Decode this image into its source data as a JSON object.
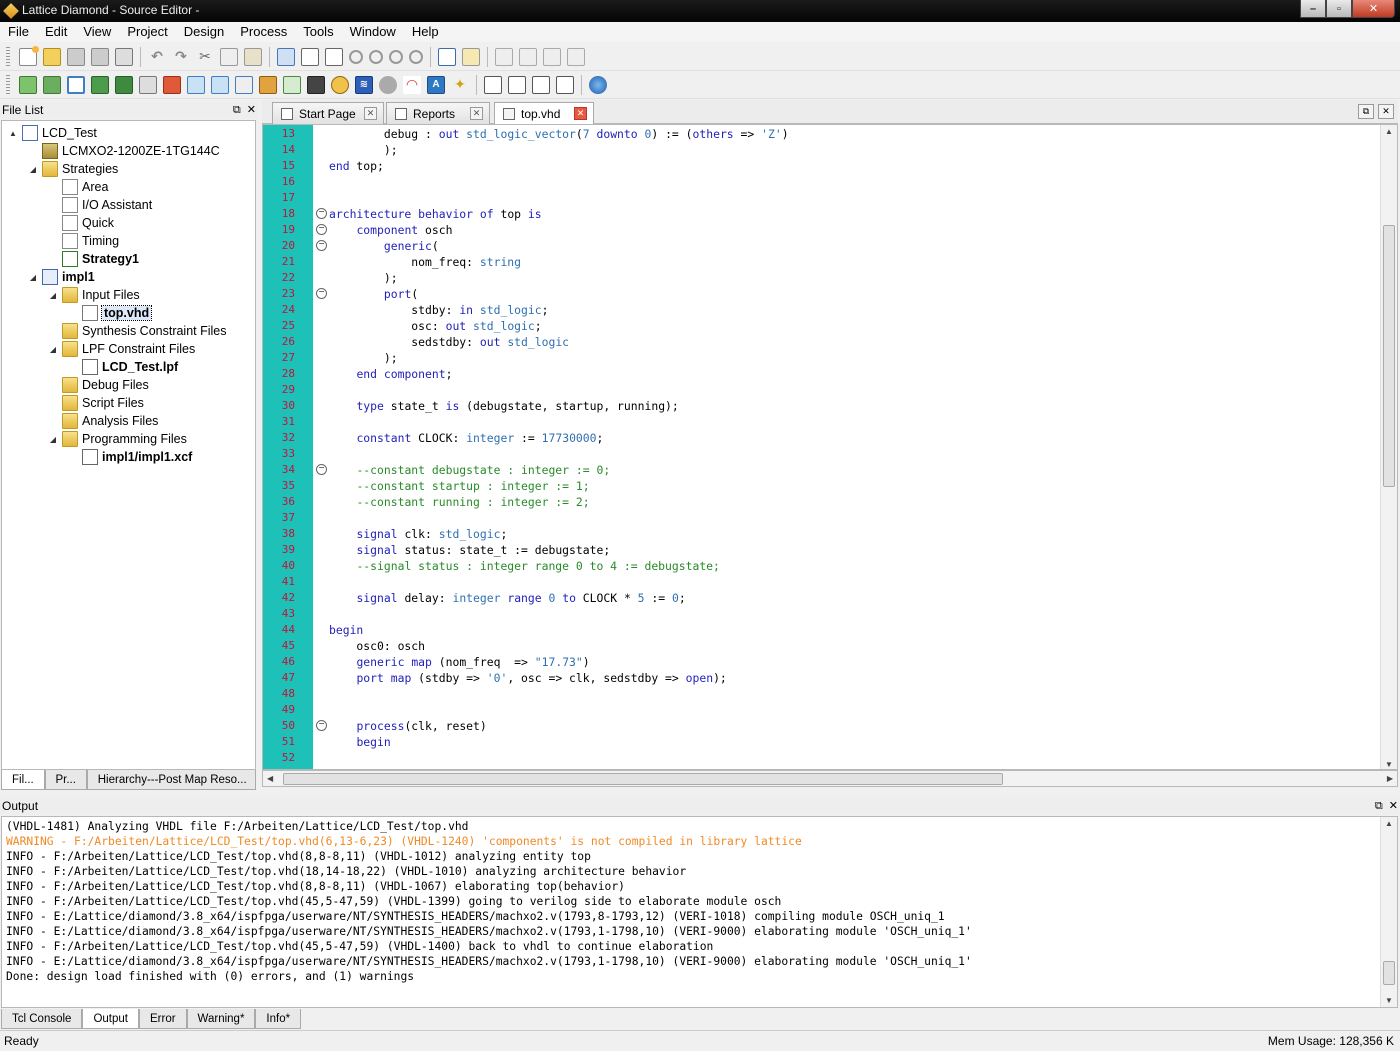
{
  "window": {
    "title": "Lattice Diamond - Source Editor -"
  },
  "menubar": [
    "File",
    "Edit",
    "View",
    "Project",
    "Design",
    "Process",
    "Tools",
    "Window",
    "Help"
  ],
  "file_list": {
    "header": "File List",
    "tree": [
      {
        "label": "LCD_Test",
        "icon": "project-icon",
        "bold": false,
        "expand": "▲",
        "level": 0
      },
      {
        "label": "LCMXO2-1200ZE-1TG144C",
        "icon": "chip-icon",
        "bold": false,
        "expand": "",
        "level": 1
      },
      {
        "label": "Strategies",
        "icon": "folder-icon",
        "bold": false,
        "expand": "◢",
        "level": 1
      },
      {
        "label": "Area",
        "icon": "strategy-icon",
        "bold": false,
        "expand": "",
        "level": 2
      },
      {
        "label": "I/O Assistant",
        "icon": "strategy-icon",
        "bold": false,
        "expand": "",
        "level": 2
      },
      {
        "label": "Quick",
        "icon": "strategy-icon",
        "bold": false,
        "expand": "",
        "level": 2
      },
      {
        "label": "Timing",
        "icon": "strategy-icon",
        "bold": false,
        "expand": "",
        "level": 2
      },
      {
        "label": "Strategy1",
        "icon": "active-strategy-icon",
        "bold": true,
        "expand": "",
        "level": 2
      },
      {
        "label": "impl1",
        "icon": "implementation-icon",
        "bold": true,
        "expand": "◢",
        "level": 1
      },
      {
        "label": "Input Files",
        "icon": "folder-icon",
        "bold": false,
        "expand": "◢",
        "level": 2
      },
      {
        "label": "top.vhd",
        "icon": "vhdl-file-icon",
        "bold": true,
        "expand": "",
        "level": 3,
        "selected": true
      },
      {
        "label": "Synthesis Constraint Files",
        "icon": "folder-icon",
        "bold": false,
        "expand": "",
        "level": 2
      },
      {
        "label": "LPF Constraint Files",
        "icon": "folder-icon",
        "bold": false,
        "expand": "◢",
        "level": 2
      },
      {
        "label": "LCD_Test.lpf",
        "icon": "file-icon",
        "bold": true,
        "expand": "",
        "level": 3
      },
      {
        "label": "Debug Files",
        "icon": "folder-icon",
        "bold": false,
        "expand": "",
        "level": 2
      },
      {
        "label": "Script Files",
        "icon": "folder-icon",
        "bold": false,
        "expand": "",
        "level": 2
      },
      {
        "label": "Analysis Files",
        "icon": "folder-icon",
        "bold": false,
        "expand": "",
        "level": 2
      },
      {
        "label": "Programming Files",
        "icon": "folder-icon",
        "bold": false,
        "expand": "◢",
        "level": 2
      },
      {
        "label": "impl1/impl1.xcf",
        "icon": "file-icon",
        "bold": true,
        "expand": "",
        "level": 3
      }
    ],
    "tabs": [
      "Fil...",
      "Pr...",
      "Hierarchy---Post Map Reso..."
    ]
  },
  "editor_tabs": [
    {
      "label": "Start Page",
      "active": false
    },
    {
      "label": "Reports",
      "active": false
    },
    {
      "label": "top.vhd",
      "active": true
    }
  ],
  "code": [
    {
      "n": "13",
      "fold": false,
      "t": "        debug : out std_logic_vector(7 downto 0) := (others => 'Z')"
    },
    {
      "n": "14",
      "fold": false,
      "t": "        );"
    },
    {
      "n": "15",
      "fold": false,
      "t": "end top;"
    },
    {
      "n": "16",
      "fold": false,
      "t": ""
    },
    {
      "n": "17",
      "fold": false,
      "t": ""
    },
    {
      "n": "18",
      "fold": true,
      "t": "architecture behavior of top is"
    },
    {
      "n": "19",
      "fold": true,
      "t": "    component osch"
    },
    {
      "n": "20",
      "fold": true,
      "t": "        generic("
    },
    {
      "n": "21",
      "fold": false,
      "t": "            nom_freq: string"
    },
    {
      "n": "22",
      "fold": false,
      "t": "        );"
    },
    {
      "n": "23",
      "fold": true,
      "t": "        port("
    },
    {
      "n": "24",
      "fold": false,
      "t": "            stdby: in std_logic;"
    },
    {
      "n": "25",
      "fold": false,
      "t": "            osc: out std_logic;"
    },
    {
      "n": "26",
      "fold": false,
      "t": "            sedstdby: out std_logic"
    },
    {
      "n": "27",
      "fold": false,
      "t": "        );"
    },
    {
      "n": "28",
      "fold": false,
      "t": "    end component;"
    },
    {
      "n": "29",
      "fold": false,
      "t": ""
    },
    {
      "n": "30",
      "fold": false,
      "t": "    type state_t is (debugstate, startup, running);"
    },
    {
      "n": "31",
      "fold": false,
      "t": ""
    },
    {
      "n": "32",
      "fold": false,
      "t": "    constant CLOCK: integer := 17730000;"
    },
    {
      "n": "33",
      "fold": false,
      "t": ""
    },
    {
      "n": "34",
      "fold": true,
      "t": "    --constant debugstate : integer := 0;"
    },
    {
      "n": "35",
      "fold": false,
      "t": "    --constant startup : integer := 1;"
    },
    {
      "n": "36",
      "fold": false,
      "t": "    --constant running : integer := 2;"
    },
    {
      "n": "37",
      "fold": false,
      "t": ""
    },
    {
      "n": "38",
      "fold": false,
      "t": "    signal clk: std_logic;"
    },
    {
      "n": "39",
      "fold": false,
      "t": "    signal status: state_t := debugstate;"
    },
    {
      "n": "40",
      "fold": false,
      "t": "    --signal status : integer range 0 to 4 := debugstate;"
    },
    {
      "n": "41",
      "fold": false,
      "t": ""
    },
    {
      "n": "42",
      "fold": false,
      "t": "    signal delay: integer range 0 to CLOCK * 5 := 0;"
    },
    {
      "n": "43",
      "fold": false,
      "t": ""
    },
    {
      "n": "44",
      "fold": false,
      "t": "begin"
    },
    {
      "n": "45",
      "fold": false,
      "t": "    osc0: osch"
    },
    {
      "n": "46",
      "fold": false,
      "t": "    generic map (nom_freq  => \"17.73\")"
    },
    {
      "n": "47",
      "fold": false,
      "t": "    port map (stdby => '0', osc => clk, sedstdby => open);"
    },
    {
      "n": "48",
      "fold": false,
      "t": ""
    },
    {
      "n": "49",
      "fold": false,
      "t": ""
    },
    {
      "n": "50",
      "fold": true,
      "t": "    process(clk, reset)"
    },
    {
      "n": "51",
      "fold": false,
      "t": "    begin"
    },
    {
      "n": "52",
      "fold": false,
      "t": ""
    }
  ],
  "output": {
    "header": "Output",
    "lines": [
      {
        "t": "(VHDL-1481) Analyzing VHDL file F:/Arbeiten/Lattice/LCD_Test/top.vhd",
        "warn": false
      },
      {
        "t": "WARNING - F:/Arbeiten/Lattice/LCD_Test/top.vhd(6,13-6,23) (VHDL-1240) 'components' is not compiled in library lattice",
        "warn": true
      },
      {
        "t": "INFO - F:/Arbeiten/Lattice/LCD_Test/top.vhd(8,8-8,11) (VHDL-1012) analyzing entity top",
        "warn": false
      },
      {
        "t": "INFO - F:/Arbeiten/Lattice/LCD_Test/top.vhd(18,14-18,22) (VHDL-1010) analyzing architecture behavior",
        "warn": false
      },
      {
        "t": "INFO - F:/Arbeiten/Lattice/LCD_Test/top.vhd(8,8-8,11) (VHDL-1067) elaborating top(behavior)",
        "warn": false
      },
      {
        "t": "INFO - F:/Arbeiten/Lattice/LCD_Test/top.vhd(45,5-47,59) (VHDL-1399) going to verilog side to elaborate module osch",
        "warn": false
      },
      {
        "t": "INFO - E:/Lattice/diamond/3.8_x64/ispfpga/userware/NT/SYNTHESIS_HEADERS/machxo2.v(1793,8-1793,12) (VERI-1018) compiling module OSCH_uniq_1",
        "warn": false
      },
      {
        "t": "INFO - E:/Lattice/diamond/3.8_x64/ispfpga/userware/NT/SYNTHESIS_HEADERS/machxo2.v(1793,1-1798,10) (VERI-9000) elaborating module 'OSCH_uniq_1'",
        "warn": false
      },
      {
        "t": "INFO - F:/Arbeiten/Lattice/LCD_Test/top.vhd(45,5-47,59) (VHDL-1400) back to vhdl to continue elaboration",
        "warn": false
      },
      {
        "t": "INFO - E:/Lattice/diamond/3.8_x64/ispfpga/userware/NT/SYNTHESIS_HEADERS/machxo2.v(1793,1-1798,10) (VERI-9000) elaborating module 'OSCH_uniq_1'",
        "warn": false
      },
      {
        "t": "Done: design load finished with (0) errors, and (1) warnings",
        "warn": false
      }
    ],
    "tabs": [
      {
        "label": "Tcl Console",
        "active": false
      },
      {
        "label": "Output",
        "active": true
      },
      {
        "label": "Error",
        "active": false
      },
      {
        "label": "Warning*",
        "active": false
      },
      {
        "label": "Info*",
        "active": false
      }
    ]
  },
  "status": {
    "left": "Ready",
    "right": "Mem Usage: 128,356 K"
  },
  "colors": {
    "gutter": "#1ec1b7",
    "line_numbers": "#c0143c",
    "keyword": "#1f1fb8",
    "type": "#2f6fb0",
    "comment": "#2a8a2a",
    "warning": "#f08a24"
  }
}
